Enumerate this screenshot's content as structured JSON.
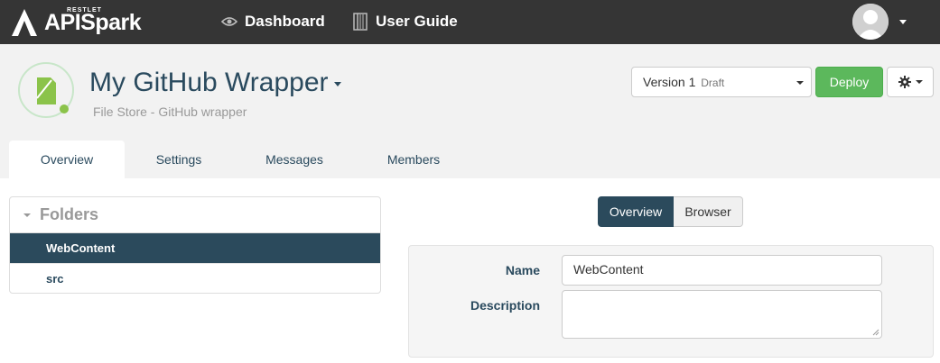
{
  "brand": {
    "name": "APISpark",
    "vendor": "RESTLET"
  },
  "nav": {
    "dashboard_label": "Dashboard",
    "user_guide_label": "User Guide",
    "dashboard_icon": "eye-icon",
    "user_guide_icon": "book-icon"
  },
  "header": {
    "title": "My GitHub Wrapper",
    "subtitle": "File Store - GitHub wrapper",
    "version_label": "Version 1",
    "version_status": "Draft",
    "deploy_label": "Deploy",
    "settings_icon": "gear-icon"
  },
  "tabs": [
    {
      "label": "Overview",
      "active": true
    },
    {
      "label": "Settings",
      "active": false
    },
    {
      "label": "Messages",
      "active": false
    },
    {
      "label": "Members",
      "active": false
    }
  ],
  "folders": {
    "title": "Folders",
    "items": [
      {
        "label": "WebContent",
        "selected": true
      },
      {
        "label": "src",
        "selected": false
      }
    ]
  },
  "view_toggle": {
    "overview_label": "Overview",
    "browser_label": "Browser",
    "active": "Overview"
  },
  "form": {
    "name_label": "Name",
    "name_value": "WebContent",
    "description_label": "Description",
    "description_value": ""
  },
  "colors": {
    "navbar": "#353535",
    "primary_dark": "#2b4a5c",
    "deploy_green": "#5cb85c",
    "header_bg": "#f2f2f2"
  }
}
